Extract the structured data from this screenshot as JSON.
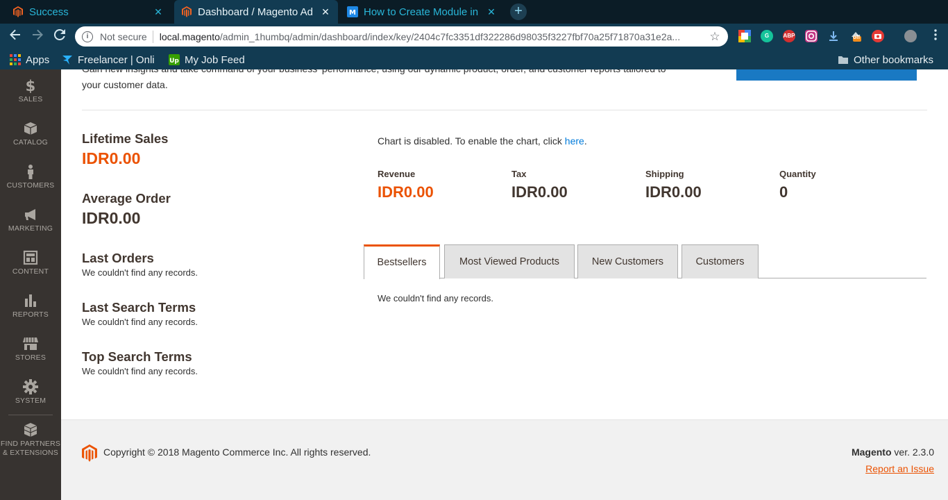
{
  "browser": {
    "tabs": [
      {
        "title": "Success",
        "close": "✕"
      },
      {
        "title": "Dashboard / Magento Ad",
        "close": "✕"
      },
      {
        "title": "How to Create Module in",
        "close": "✕"
      }
    ],
    "new_tab": "+",
    "security": "Not secure",
    "url_host": "local.magento",
    "url_path": "/admin_1humbq/admin/dashboard/index/key/2404c7fc3351df322286d98035f3227fbf70a25f71870a31e2a...",
    "bookmarks": {
      "apps": "Apps",
      "freelancer": "Freelancer | Onli",
      "job_feed": "My Job Feed",
      "other": "Other bookmarks"
    },
    "extensions": {
      "abp": "ABP",
      "off": "off"
    }
  },
  "sidebar": {
    "items": [
      {
        "label": "SALES",
        "icon": "dollar-icon"
      },
      {
        "label": "CATALOG",
        "icon": "box-icon"
      },
      {
        "label": "CUSTOMERS",
        "icon": "person-icon"
      },
      {
        "label": "MARKETING",
        "icon": "megaphone-icon"
      },
      {
        "label": "CONTENT",
        "icon": "layout-icon"
      },
      {
        "label": "REPORTS",
        "icon": "bar-chart-icon"
      },
      {
        "label": "STORES",
        "icon": "store-icon"
      },
      {
        "label": "SYSTEM",
        "icon": "gear-icon"
      }
    ],
    "partners_line1": "FIND PARTNERS",
    "partners_line2": "& EXTENSIONS"
  },
  "dashboard": {
    "intro_line1": "Gain new insights and take command of your business' performance, using our dynamic product, order, and customer reports tailored to",
    "intro_line2": "your customer data.",
    "lifetime_sales_title": "Lifetime Sales",
    "lifetime_sales_value": "IDR0.00",
    "average_order_title": "Average Order",
    "average_order_value": "IDR0.00",
    "last_orders_title": "Last Orders",
    "last_orders_empty": "We couldn't find any records.",
    "last_search_title": "Last Search Terms",
    "last_search_empty": "We couldn't find any records.",
    "top_search_title": "Top Search Terms",
    "top_search_empty": "We couldn't find any records.",
    "chart_msg": "Chart is disabled. To enable the chart, click ",
    "chart_link": "here",
    "chart_msg_end": ".",
    "totals": [
      {
        "label": "Revenue",
        "value": "IDR0.00"
      },
      {
        "label": "Tax",
        "value": "IDR0.00"
      },
      {
        "label": "Shipping",
        "value": "IDR0.00"
      },
      {
        "label": "Quantity",
        "value": "0"
      }
    ],
    "tabs": [
      "Bestsellers",
      "Most Viewed Products",
      "New Customers",
      "Customers"
    ],
    "active_tab": "Bestsellers",
    "tab_empty": "We couldn't find any records."
  },
  "footer": {
    "copyright": "Copyright © 2018 Magento Commerce Inc. All rights reserved.",
    "brand": "Magento",
    "version": " ver. 2.3.0",
    "report": "Report an Issue"
  },
  "colors": {
    "accent": "#eb5202",
    "sidebar_bg": "#373330",
    "link": "#007bdb",
    "browser_frame": "#123b52"
  }
}
